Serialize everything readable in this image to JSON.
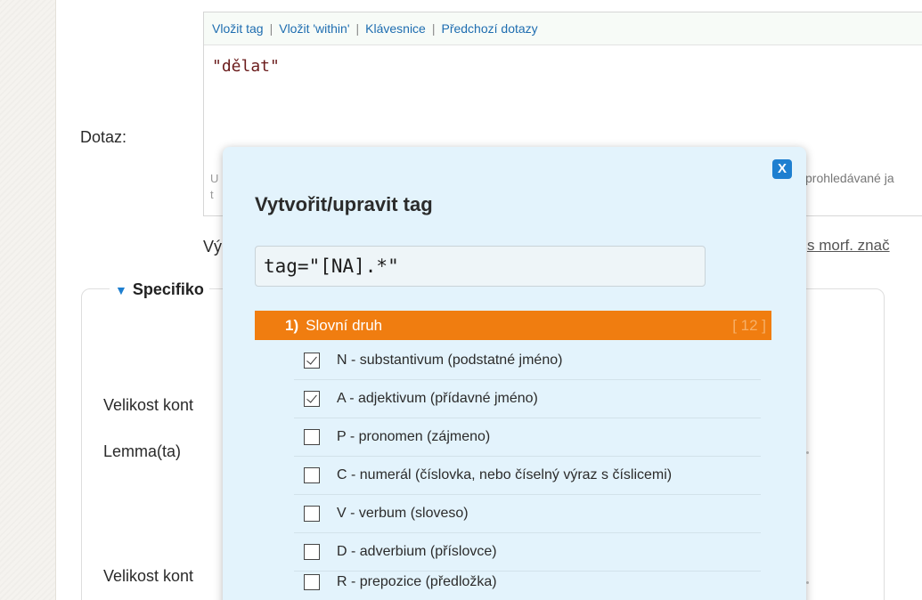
{
  "toolbar": {
    "items": [
      "Vložit tag",
      "Vložit 'within'",
      "Klávesnice",
      "Předchozí dotazy"
    ],
    "separator": "|"
  },
  "query": {
    "value": "\"dělat\"",
    "hint_left_1": "U",
    "hint_left_2": "t",
    "hint_right": "prohledávané ja"
  },
  "labels": {
    "dotaz": "Dotaz:",
    "vy": "Vý",
    "morf_link": "s morf. znač",
    "specifikace": "Specifiko",
    "velikost1": "Velikost kont",
    "lemma": "Lemma(ta)",
    "velikost2": "Velikost kont"
  },
  "modal": {
    "close": "X",
    "title": "Vytvořit/upravit tag",
    "tag_value": "tag=\"[NA].*\"",
    "section": {
      "number": "1)",
      "label": "Slovní druh",
      "count": "[ 12 ]"
    },
    "options": [
      {
        "label": "N - substantivum (podstatné jméno)",
        "checked": true
      },
      {
        "label": "A - adjektivum (přídavné jméno)",
        "checked": true
      },
      {
        "label": "P - pronomen (zájmeno)",
        "checked": false
      },
      {
        "label": "C - numerál (číslovka, nebo číselný výraz s číslicemi)",
        "checked": false
      },
      {
        "label": "V - verbum (sloveso)",
        "checked": false
      },
      {
        "label": "D - adverbium (příslovce)",
        "checked": false
      },
      {
        "label": "R - prepozice (předložka)",
        "checked": false
      }
    ]
  },
  "colors": {
    "accent": "#f07d10",
    "link": "#1e6db0",
    "modal_bg": "#e3f3fc",
    "close_button": "#1e7fd0"
  }
}
